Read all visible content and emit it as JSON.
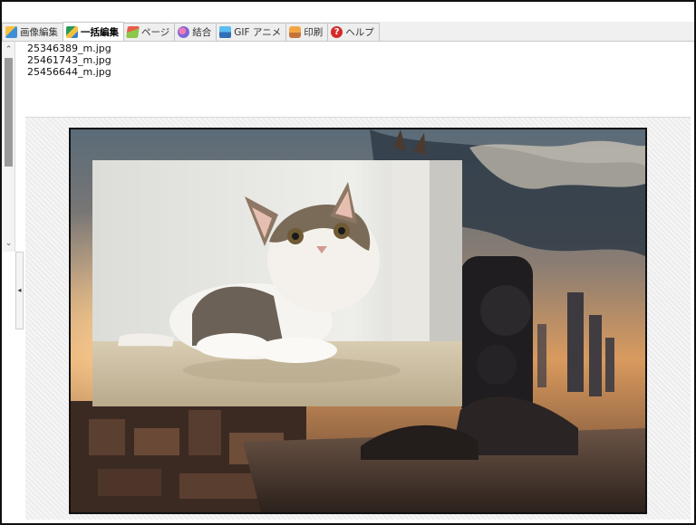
{
  "tabs": [
    {
      "label": "画像編集",
      "icon": "image-edit-icon",
      "active": false
    },
    {
      "label": "一括編集",
      "icon": "batch-edit-icon",
      "active": true
    },
    {
      "label": "ページ",
      "icon": "page-icon",
      "active": false
    },
    {
      "label": "結合",
      "icon": "combine-icon",
      "active": false
    },
    {
      "label": "GIF アニメ",
      "icon": "gif-animation-icon",
      "active": false
    },
    {
      "label": "印刷",
      "icon": "print-icon",
      "active": false
    },
    {
      "label": "ヘルプ",
      "icon": "help-icon",
      "active": false
    }
  ],
  "file_list": {
    "items": [
      "25346389_m.jpg",
      "25461743_m.jpg",
      "25456644_m.jpg"
    ]
  },
  "help_glyph": "?",
  "scroll": {
    "up_glyph": "⌃",
    "down_glyph": "⌄"
  },
  "splitter_glyph": "◂",
  "preview": {
    "background_image": "sci-fi-city-ruins-sunset",
    "overlay_image": "tabby-cat-looking-up"
  },
  "colors": {
    "active_tab": "#ffffff",
    "tab_bar": "#f0f0f0",
    "preview_bg": "#ececec"
  }
}
